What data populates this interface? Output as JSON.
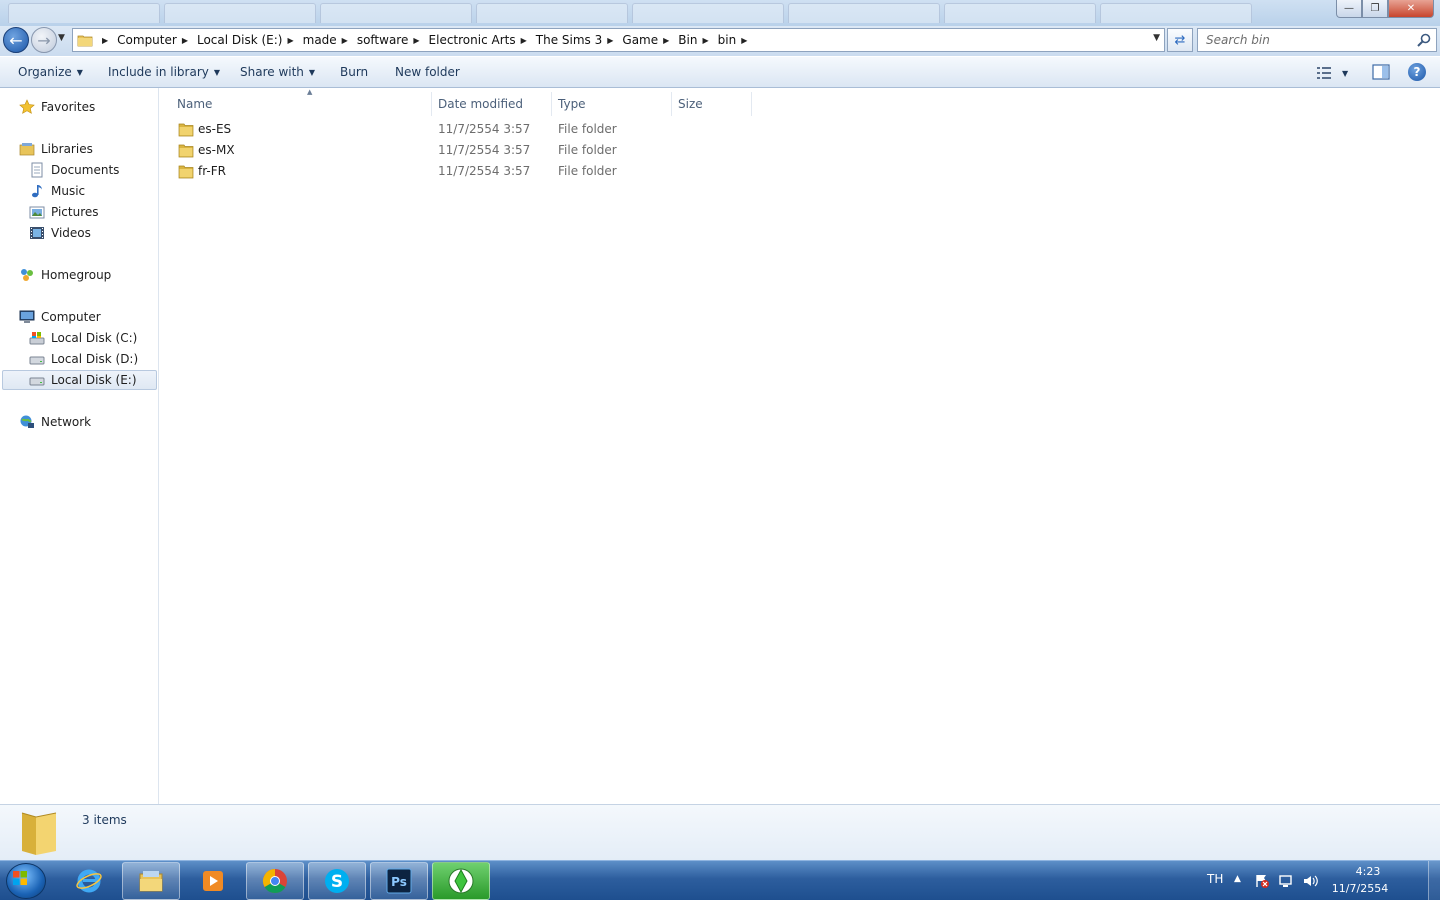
{
  "address_bar": {
    "breadcrumbs": [
      "Computer",
      "Local Disk (E:)",
      "made",
      "software",
      "Electronic Arts",
      "The Sims 3",
      "Game",
      "Bin",
      "bin"
    ]
  },
  "search": {
    "placeholder": "Search bin"
  },
  "toolbar": {
    "organize": "Organize",
    "include_in_library": "Include in library",
    "share_with": "Share with",
    "burn": "Burn",
    "new_folder": "New folder"
  },
  "nav_pane": {
    "favorites": "Favorites",
    "libraries": "Libraries",
    "documents": "Documents",
    "music": "Music",
    "pictures": "Pictures",
    "videos": "Videos",
    "homegroup": "Homegroup",
    "computer": "Computer",
    "disk_c": "Local Disk (C:)",
    "disk_d": "Local Disk (D:)",
    "disk_e": "Local Disk (E:)",
    "network": "Network"
  },
  "columns": {
    "name": "Name",
    "date_modified": "Date modified",
    "type": "Type",
    "size": "Size"
  },
  "files": [
    {
      "name": "es-ES",
      "date": "11/7/2554 3:57",
      "type": "File folder"
    },
    {
      "name": "es-MX",
      "date": "11/7/2554 3:57",
      "type": "File folder"
    },
    {
      "name": "fr-FR",
      "date": "11/7/2554 3:57",
      "type": "File folder"
    }
  ],
  "details": {
    "item_count": "3 items"
  },
  "taskbar": {
    "language": "TH",
    "time": "4:23",
    "date": "11/7/2554"
  },
  "colors": {
    "accent": "#1e395b",
    "selection": "#dfe8f3",
    "taskbar": "#2d5e9e"
  }
}
